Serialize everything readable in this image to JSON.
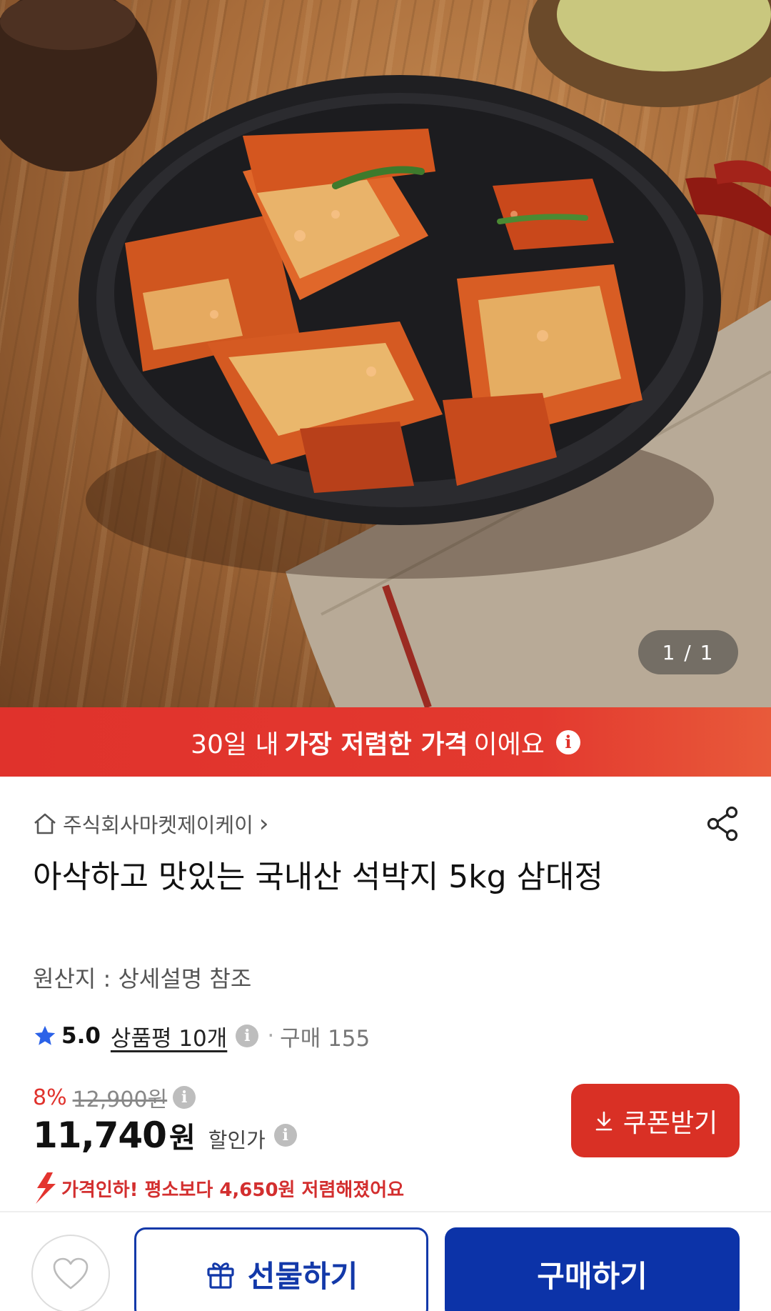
{
  "hero": {
    "image_alt": "",
    "counter": "1 / 1"
  },
  "banner": {
    "prefix": "30일 내",
    "emphasis": "가장 저렴한 가격",
    "suffix": "이에요",
    "info_icon": "info-icon"
  },
  "product": {
    "seller": "주식회사마켓제이케이",
    "seller_chevron": "›",
    "title": "아삭하고 맛있는 국내산 석박지 5kg 삼대정",
    "origin": "원산지 : 상세설명 참조",
    "rating": "5.0",
    "review_link": "상품평 10개",
    "purchase_count": "구매 155",
    "discount_rate": "8%",
    "original_price": "12,900원",
    "price": "11,740",
    "price_unit": "원",
    "price_label": "할인가",
    "price_drop_note": "가격인하! 평소보다 4,650원 저렴해졌어요"
  },
  "coupon_button": {
    "label": "쿠폰받기"
  },
  "bottom_bar": {
    "gift_label": "선물하기",
    "buy_label": "구매하기"
  },
  "colors": {
    "banner_red": "#e0322c",
    "coupon_red": "#d93025",
    "primary_blue": "#0c33a8",
    "star_blue": "#2b62e8"
  }
}
